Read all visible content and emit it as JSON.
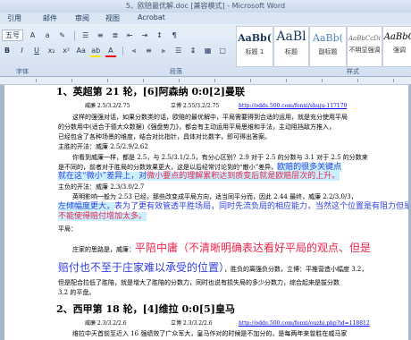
{
  "window": {
    "title": "5、欧赔最优解.doc [兼容模式] - Microsoft Word"
  },
  "menu": {
    "items": [
      "引用",
      "邮件",
      "审阅",
      "视图",
      "Acrobat"
    ]
  },
  "ribbon": {
    "font_size": "五号",
    "group_font": "字体",
    "group_paragraph": "段落",
    "group_styles": "样式",
    "styles": [
      {
        "sample": "AaBb(",
        "name": "标题 1"
      },
      {
        "sample": "AaBl",
        "name": "标题"
      },
      {
        "sample": "AaBb(",
        "name": "副标题"
      },
      {
        "sample": "AaBbCcDi",
        "name": "不明显强调"
      },
      {
        "sample": "AaBbC",
        "name": "强调"
      }
    ]
  },
  "doc": {
    "h1": "1、英超第 21 轮，[6]阿森纳 0:0[2]曼联",
    "m1a": "威廉 2.5/3.2/2.75",
    "m1b": "立博 2.55/3.2/2.75",
    "m1c": "http://odds.500.com/fenxi/shuju-117179",
    "p1_1": "这样的强强对话，如果分数类的话，欧赔的最优解中，平局需要得到合适的运用，就是充分使用平局",
    "p1_2": "的分数用中(适合于德大众数据)《强盘势力》，都会有主动运用平局思维和手法，主动阻挡敌方推入，",
    "p1_3": "已经包含了各种场景的维度，结合对比指针，具体对比数字，即可得出答案。",
    "s1": "主胜的开法：威廉 2.5/2.9/2.62",
    "p1_4": "你看到威廉一样，都是 2.5，与 2.5/3.1/2.5，有分心区别？2.9 对于 2.5 的分数与 3.1 对于 2.5 的分数来",
    "p1_5a": "是不同的，前者对于胜局的分数效果更大，这是以后经常讨论到的“散小”差异，",
    "p1_5b": "欧赔的很多关键点",
    "p1_6a": "就在这“微小”差异上，对",
    "p1_6b": "微小要点的理解累积达到质变后就是欧赔层次的上升。",
    "s2": "主负的开法：威廉 2.3/3.0/2.7",
    "p1_7": "英明影响一般为 2.53 已经，那些改变成平局方向，适当同平分而，因此 2.44 最终，威廉 2.2/3.0/3，",
    "p1_8a": "左倾幅度更大，",
    "p1_8b": "表为了更有效管透平胜场局，同时先流负局的相应能力，当然这个位置是有阻力但是也",
    "p1_9": "不能使得赔付增加太多。",
    "s3": "平局：",
    "p2a": "庄家的思路是，威廉：",
    "p2b": "平陪中庸（不清晰明确表达看好平局的观点、但是",
    "p2c": "赔付也不至于庄家难以承受的位置）",
    "p2d": "，胜负的离强负分数，立博：平推营造小幅度 3.2，",
    "p3_1": "但是配合拉低了胜陪，就是增大了胜陪的分数力，同时也说有损失局的多少分数力，综合起来是拔分数",
    "p3_2": "3.2 的平盘。",
    "h2": "2、西甲第 18 轮，[4]维拉 0:0[5]皇马",
    "m2a": "威廉 2.3/3.2/2.6",
    "m2b": "立博 2.3/3.2/2.6",
    "m2c": "http://odds.500.com/fenxi/ouzhi.php?id=118812",
    "p4_1": "维拉中天首前至近入 16 强绩效了广众军大，皇马作对的时候是不加分的，是每两年来曾胜在威马家"
  }
}
